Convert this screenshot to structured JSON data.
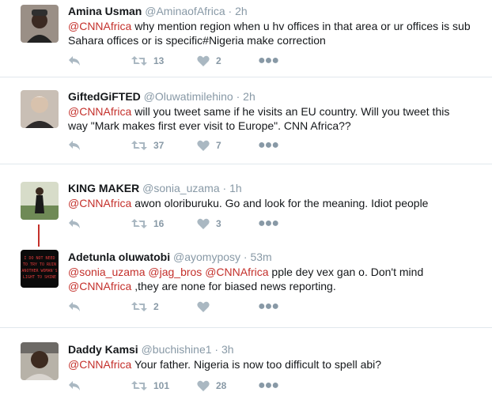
{
  "tweets": [
    {
      "name": "Amina Usman",
      "handle": "@AminaofAfrica",
      "time": "2h",
      "body_parts": [
        {
          "t": "@CNNAfrica",
          "m": true
        },
        {
          "t": " why mention region when u hv offices in that area or ur offices is sub Sahara offices or is specific#Nigeria make correction",
          "m": false
        }
      ],
      "retweets": "13",
      "likes": "2",
      "avatar_icon": "user-avatar"
    },
    {
      "name": "GiftedGiFTED",
      "handle": "@Oluwatimilehino",
      "time": "2h",
      "body_parts": [
        {
          "t": "@CNNAfrica",
          "m": true
        },
        {
          "t": " will you tweet same if he visits an EU country. Will you tweet this way \"Mark makes first ever visit to Europe\".  CNN Africa??",
          "m": false
        }
      ],
      "retweets": "37",
      "likes": "7",
      "avatar_icon": "user-avatar"
    },
    {
      "name": "KING MAKER",
      "handle": "@sonia_uzama",
      "time": "1h",
      "body_parts": [
        {
          "t": "@CNNAfrica",
          "m": true
        },
        {
          "t": " awon oloriburuku. Go and look for the meaning. Idiot people",
          "m": false
        }
      ],
      "retweets": "16",
      "likes": "3",
      "avatar_icon": "user-avatar"
    },
    {
      "name": "Adetunla oluwatobi",
      "handle": "@ayomyposy",
      "time": "53m",
      "body_parts": [
        {
          "t": "@sonia_uzama",
          "m": true
        },
        {
          "t": " ",
          "m": false
        },
        {
          "t": "@jag_bros",
          "m": true
        },
        {
          "t": " ",
          "m": false
        },
        {
          "t": "@CNNAfrica",
          "m": true
        },
        {
          "t": " pple dey vex gan o. Don't mind ",
          "m": false
        },
        {
          "t": "@CNNAfrica",
          "m": true
        },
        {
          "t": " ,they are none for biased news reporting.",
          "m": false
        }
      ],
      "retweets": "2",
      "likes": "",
      "avatar_icon": "user-avatar",
      "avatar_text": "I DO NOT NEED TO TRY TO RUIN ANOTHER WOMAN'S LIGHT TO SHINE"
    },
    {
      "name": "Daddy Kamsi",
      "handle": "@buchishine1",
      "time": "3h",
      "body_parts": [
        {
          "t": "@CNNAfrica",
          "m": true
        },
        {
          "t": " Your father. Nigeria is now too difficult to spell abi?",
          "m": false
        }
      ],
      "retweets": "101",
      "likes": "28",
      "avatar_icon": "user-avatar"
    }
  ],
  "separator": "·",
  "colors": {
    "mention": "#c4302b",
    "meta": "#8899a6",
    "divider": "#e1e8ed",
    "thread": "#c4302b"
  },
  "icons": {
    "reply": "reply-icon",
    "retweet": "retweet-icon",
    "like": "heart-icon",
    "more": "more-icon"
  }
}
